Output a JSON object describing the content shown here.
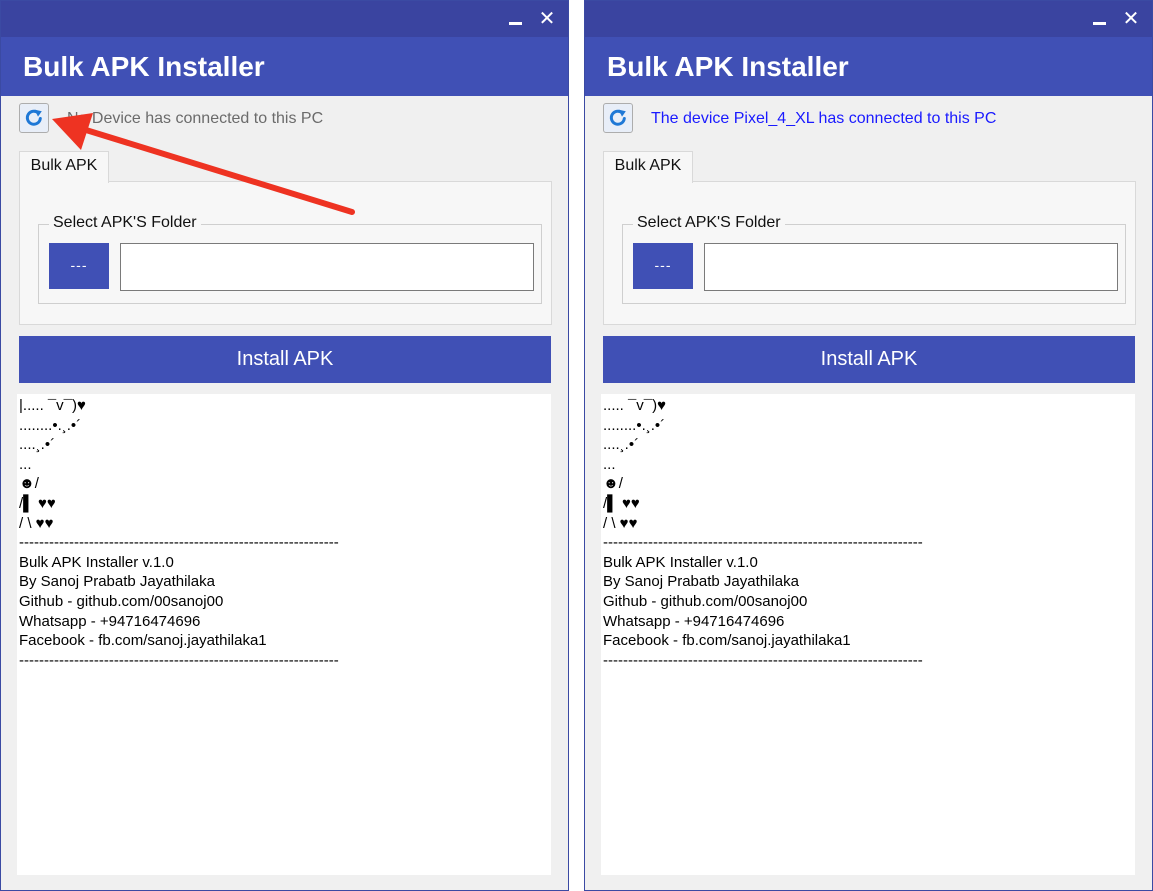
{
  "windows": [
    {
      "title": "Bulk APK Installer",
      "status": "No Device has connected to this PC",
      "status_color": "#6b6b6b",
      "tab_label": "Bulk APK",
      "group_label": "Select APK'S Folder",
      "browse_label": "---",
      "folder_value": "",
      "install_label": "Install APK",
      "console_lines": [
        "|..... ¯v¯)♥",
        "........•.¸.•´",
        "....¸.•´",
        "...",
        "☻/",
        "/▌ ♥♥",
        "/ \\ ♥♥",
        "----------------------------------------------------------------",
        "Bulk APK Installer v.1.0",
        "By Sanoj Prabatb Jayathilaka",
        "Github - github.com/00sanoj00",
        "Whatsapp - +94716474696",
        "Facebook - fb.com/sanoj.jayathilaka1",
        "----------------------------------------------------------------"
      ]
    },
    {
      "title": "Bulk APK Installer",
      "status": "The device Pixel_4_XL has connected to this PC",
      "status_color": "#1a1aff",
      "tab_label": "Bulk APK",
      "group_label": "Select APK'S Folder",
      "browse_label": "---",
      "folder_value": "",
      "install_label": "Install APK",
      "console_lines": [
        "..... ¯v¯)♥",
        "........•.¸.•´",
        "....¸.•´",
        "...",
        "☻/",
        "/▌ ♥♥",
        "/ \\ ♥♥",
        "----------------------------------------------------------------",
        "Bulk APK Installer v.1.0",
        "By Sanoj Prabatb Jayathilaka",
        "Github - github.com/00sanoj00",
        "Whatsapp - +94716474696",
        "Facebook - fb.com/sanoj.jayathilaka1",
        "----------------------------------------------------------------"
      ]
    }
  ],
  "icons": {
    "minimize": "minimize-icon",
    "close": "close-icon",
    "close_glyph": "✕",
    "refresh": "refresh-icon"
  },
  "colors": {
    "titlebar": "#3a44a0",
    "header": "#4050b5",
    "accent": "#4050b5",
    "annotation_arrow": "#ee3322"
  }
}
